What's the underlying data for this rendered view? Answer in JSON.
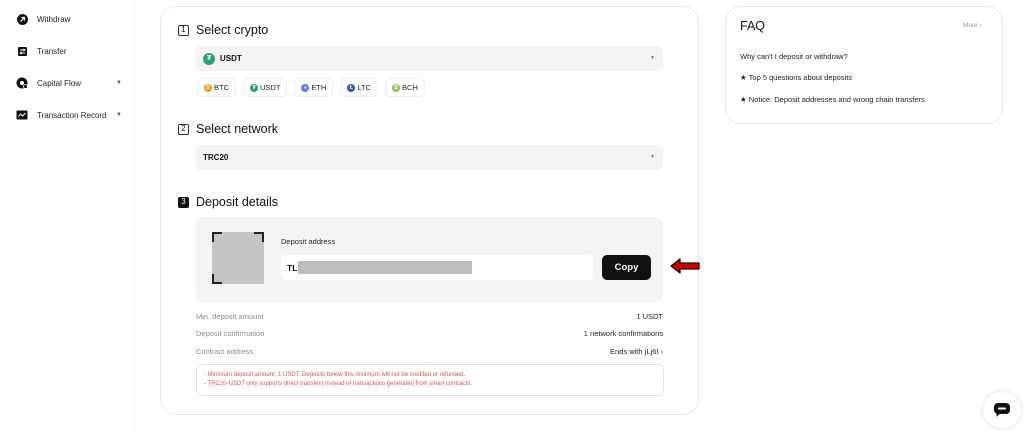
{
  "sidebar": {
    "items": [
      {
        "label": "Withdraw",
        "icon": "withdraw-icon"
      },
      {
        "label": "Transfer",
        "icon": "transfer-icon"
      },
      {
        "label": "Capital Flow",
        "icon": "capital-flow-icon",
        "expandable": true
      },
      {
        "label": "Transaction Record",
        "icon": "record-icon",
        "expandable": true
      }
    ]
  },
  "steps": {
    "select_crypto": {
      "number": "1",
      "title": "Select crypto",
      "selected": "USDT"
    },
    "select_network": {
      "number": "2",
      "title": "Select network",
      "selected": "TRC20"
    },
    "deposit_details": {
      "number": "3",
      "title": "Deposit details"
    }
  },
  "coins": [
    {
      "label": "BTC",
      "color": "#f7931a"
    },
    {
      "label": "USDT",
      "color": "#26a17b"
    },
    {
      "label": "ETH",
      "color": "#627eea"
    },
    {
      "label": "LTC",
      "color": "#345d9d"
    },
    {
      "label": "BCH",
      "color": "#8dc351"
    }
  ],
  "deposit": {
    "address_label": "Deposit address",
    "address_prefix": "TL",
    "copy_label": "Copy"
  },
  "info_rows": [
    {
      "key": "Min. deposit amount",
      "value": "1 USDT"
    },
    {
      "key": "Deposit confirmation",
      "value": "1 network confirmations"
    },
    {
      "key": "Contract address",
      "value": "Ends with jLj6t ›"
    }
  ],
  "notices": [
    "- Minimum deposit amount: 1 USDT. Deposits below this minimum will not be credited or refunded.",
    "- TRC20-USDT only supports direct transfers instead of transactions generated from smart contracts."
  ],
  "faq": {
    "title": "FAQ",
    "more": "More ›",
    "items": [
      "Why can't I deposit or withdraw?",
      "★ Top 5 questions about deposits",
      "★ Notice: Deposit addresses and wrong chain transfers"
    ]
  },
  "colors": {
    "accent": "#111111",
    "notice_text": "#e05050",
    "annotation_arrow": "#d40000"
  }
}
